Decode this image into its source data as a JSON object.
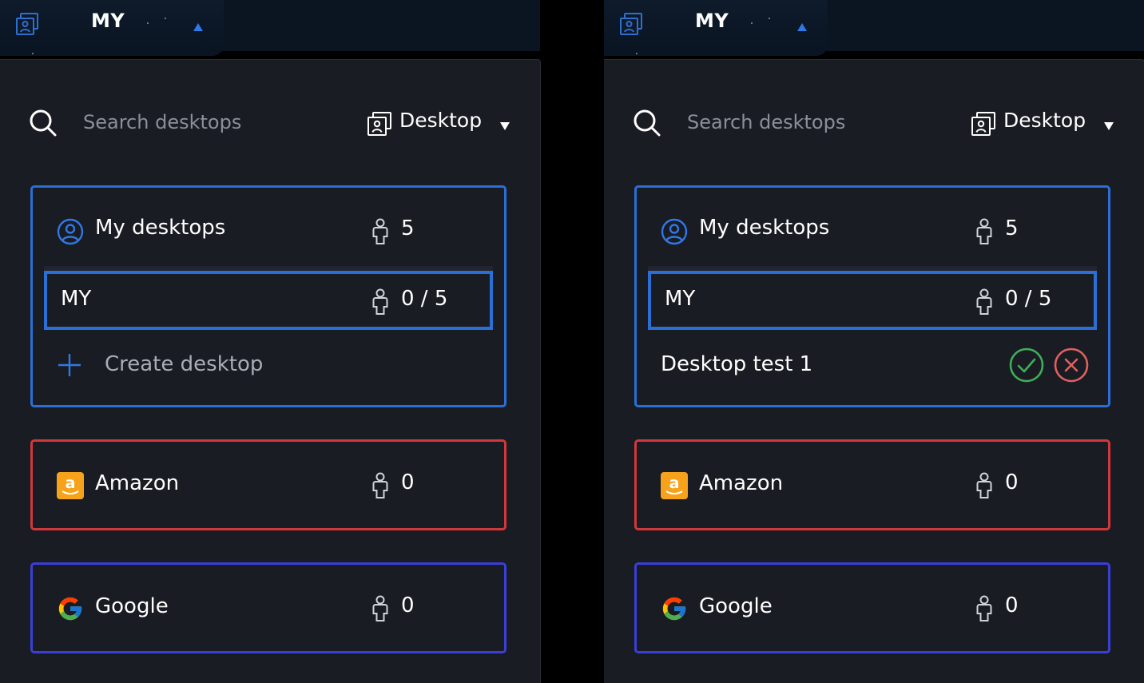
{
  "colors": {
    "blue_border": "#2a6fd6",
    "red_border": "#d0383c",
    "indigo_border": "#3a3fd8",
    "confirm_green": "#3fae5a",
    "cancel_red": "#e0605f",
    "amazon_orange": "#f7a21b"
  },
  "panels": [
    {
      "topbar": {
        "title": "MY",
        "caret_icon": "caret-up-icon"
      },
      "search": {
        "placeholder": "Search desktops",
        "value": ""
      },
      "filter": {
        "label": "Desktop",
        "icon": "desktop-icon"
      },
      "groups": {
        "mine": {
          "label": "My desktops",
          "count": "5",
          "icon": "user-circle-icon"
        },
        "desktop_row": {
          "name": "MY",
          "count": "0 / 5"
        },
        "create": {
          "label": "Create desktop",
          "icon": "plus-icon"
        },
        "amazon": {
          "label": "Amazon",
          "count": "0",
          "logo": "a"
        },
        "google": {
          "label": "Google",
          "count": "0"
        }
      }
    },
    {
      "topbar": {
        "title": "MY",
        "caret_icon": "caret-up-icon"
      },
      "search": {
        "placeholder": "Search desktops",
        "value": ""
      },
      "filter": {
        "label": "Desktop",
        "icon": "desktop-icon"
      },
      "groups": {
        "mine": {
          "label": "My desktops",
          "count": "5",
          "icon": "user-circle-icon"
        },
        "desktop_row": {
          "name": "MY",
          "count": "0 / 5"
        },
        "edit": {
          "name": "Desktop test 1",
          "confirm_icon": "check-circle-icon",
          "cancel_icon": "x-circle-icon"
        },
        "amazon": {
          "label": "Amazon",
          "count": "0",
          "logo": "a"
        },
        "google": {
          "label": "Google",
          "count": "0"
        }
      }
    }
  ]
}
